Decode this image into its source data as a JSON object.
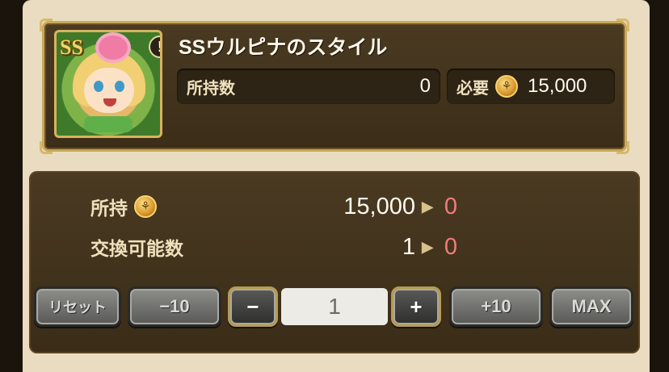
{
  "item": {
    "badge": "SS",
    "info_icon": "!",
    "name": "SSウルピナのスタイル",
    "owned_label": "所持数",
    "owned_value": "0",
    "cost_label": "必要",
    "cost_value": "15,000"
  },
  "exchange": {
    "balance_label": "所持",
    "balance_from": "15,000",
    "balance_to": "0",
    "count_label": "交換可能数",
    "count_from": "1",
    "count_to": "0"
  },
  "controls": {
    "reset": "リセット",
    "minus10": "−10",
    "minus": "−",
    "quantity": "1",
    "plus": "+",
    "plus10": "+10",
    "max": "MAX"
  },
  "icons": {
    "coin": "coin-icon",
    "arrow": "arrow-right-icon"
  },
  "colors": {
    "after_value": "#f07c7c",
    "gold_frame": "#c9a85c"
  }
}
